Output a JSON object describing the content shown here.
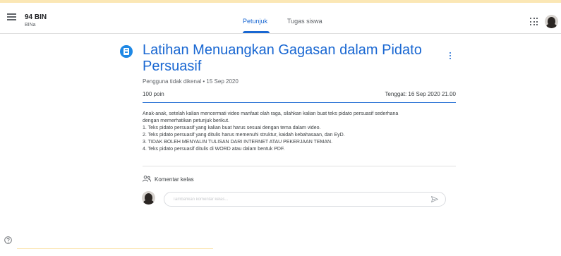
{
  "header": {
    "class_name": "94 BIN",
    "class_sub": "BINa",
    "tabs": [
      {
        "label": "Petunjuk",
        "active": true
      },
      {
        "label": "Tugas siswa",
        "active": false
      }
    ],
    "icons": [
      "menu-icon",
      "apps-grid-icon",
      "user-avatar"
    ]
  },
  "assignment": {
    "title": "Latihan Menuangkan Gagasan dalam Pidato Persuasif",
    "author_date": "Pengguna tidak dikenal • 15 Sep 2020",
    "points": "100 poin",
    "due": "Tenggat: 16 Sep 2020 21.00",
    "instructions": [
      "Anak-anak, setelah kalian mencermati video manfaat olah raga, silahkan kalian buat teks pidato persuasif sederhana",
      "dengan memerhatikan petunjuk berikut.",
      "1. Teks pidato persuasif yang kalian buat harus sesuai dengan tema dalam video.",
      "2. Teks pidato persuasif yang ditulis harus memenuhi struktur, kaidah kebahasaan, dan EyD.",
      "3. TIDAK BOLEH MENYALIN TULISAN DARI INTERNET ATAU PEKERJAAN TEMAN.",
      "4. Teks pidato persuasif ditulis di WORD atau dalam bentuk PDF."
    ]
  },
  "comments": {
    "label": "Komentar kelas",
    "placeholder": "Tambahkan komentar kelas..."
  },
  "colors": {
    "accent": "#1967d2",
    "assignment_icon": "#1e88e5",
    "top_strip": "#fbe7b5"
  }
}
